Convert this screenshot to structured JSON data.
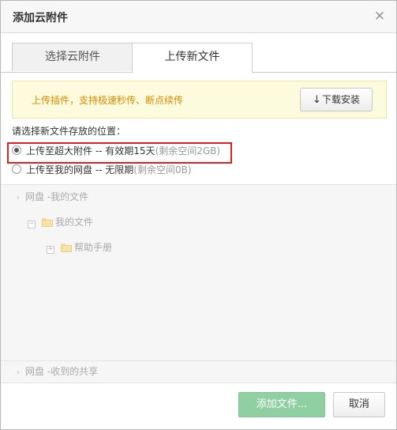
{
  "dialog": {
    "title": "添加云附件",
    "close_symbol": "×"
  },
  "tabs": [
    {
      "label": "选择云附件",
      "active": false
    },
    {
      "label": "上传新文件",
      "active": true
    }
  ],
  "notice": {
    "text": "上传插件，支持极速秒传、断点续传",
    "download_label": "下载安装",
    "download_icon": "download-arrow-icon"
  },
  "location": {
    "prompt": "请选择新文件存放的位置：",
    "options": [
      {
        "label": "上传至超大附件 -- 有效期15天",
        "note": "(剩余空间2GB)",
        "checked": true
      },
      {
        "label": "上传至我的网盘 -- 无限期",
        "note": "(剩余空间0B)",
        "checked": false
      }
    ]
  },
  "tree": {
    "root": {
      "toggle": "›",
      "label": "网盘 -我的文件"
    },
    "items": [
      {
        "toggle": "−",
        "label": "我的文件"
      },
      {
        "toggle": "+",
        "label": "帮助手册"
      }
    ],
    "shared": {
      "toggle": "›",
      "label": "网盘 -收到的共享"
    }
  },
  "footer": {
    "add_label": "添加文件...",
    "cancel_label": "取消"
  },
  "colors": {
    "notice_text": "#d98a00",
    "add_button": "#8fcfa2",
    "highlight": "#e02020"
  }
}
